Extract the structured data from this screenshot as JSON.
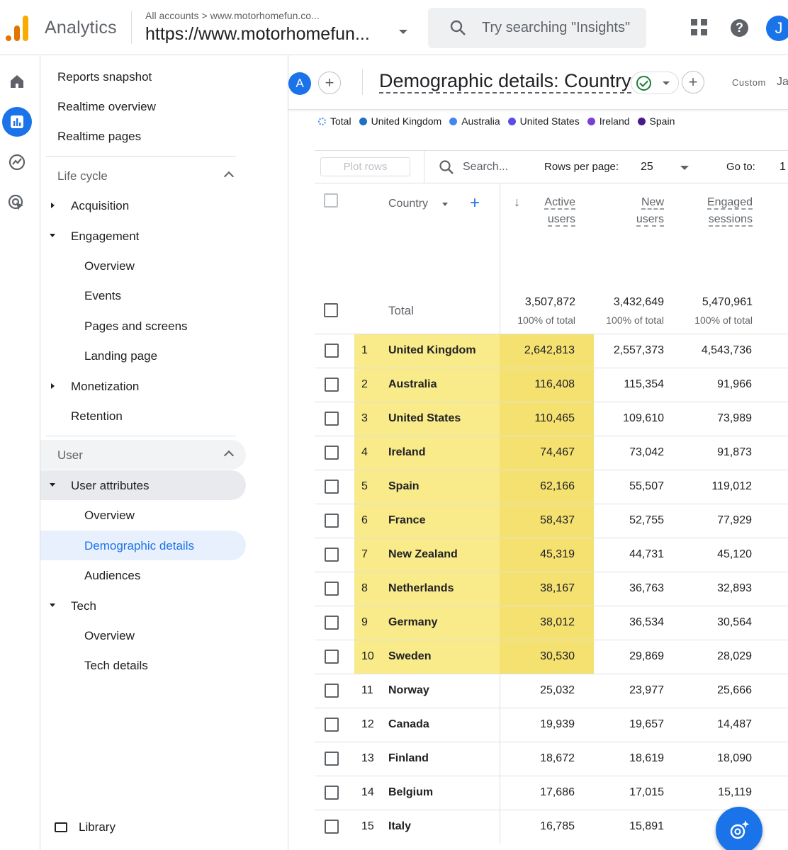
{
  "header": {
    "app_name": "Analytics",
    "breadcrumb_root": "All accounts",
    "breadcrumb_sep": ">",
    "breadcrumb_account": "www.motorhomefun.co...",
    "property": "https://www.motorhomefun...",
    "search_placeholder": "Try searching \"Insights\"",
    "help_glyph": "?",
    "avatar_initial": "J"
  },
  "nav": {
    "reports_snapshot": "Reports snapshot",
    "realtime_overview": "Realtime overview",
    "realtime_pages": "Realtime pages",
    "lifecycle_section": "Life cycle",
    "acquisition": "Acquisition",
    "engagement": "Engagement",
    "eng_overview": "Overview",
    "eng_events": "Events",
    "eng_pages": "Pages and screens",
    "eng_landing": "Landing page",
    "monetization": "Monetization",
    "retention": "Retention",
    "user_section": "User",
    "user_attributes": "User attributes",
    "ua_overview": "Overview",
    "ua_demographic": "Demographic details",
    "ua_audiences": "Audiences",
    "tech": "Tech",
    "tech_overview": "Overview",
    "tech_details": "Tech details",
    "library": "Library"
  },
  "report": {
    "segment_initial": "A",
    "plus": "+",
    "title": "Demographic details: Country",
    "custom_label": "Custom",
    "date_partial": "Ja"
  },
  "legend": [
    {
      "label": "Total",
      "color": "#4285f4"
    },
    {
      "label": "United Kingdom",
      "color": "#1f6fc5"
    },
    {
      "label": "Australia",
      "color": "#4285f4"
    },
    {
      "label": "United States",
      "color": "#5b4ee8"
    },
    {
      "label": "Ireland",
      "color": "#7b3fd6"
    },
    {
      "label": "Spain",
      "color": "#4a1a8c"
    }
  ],
  "toolbar": {
    "plot_rows": "Plot rows",
    "search_placeholder": "Search...",
    "rows_per_page_label": "Rows per page:",
    "rows_per_page_value": "25",
    "goto_label": "Go to:",
    "goto_value": "1"
  },
  "table": {
    "dim_header": "Country",
    "sort_arrow": "↓",
    "metric_headers": [
      {
        "line1": "Active",
        "line2": "users"
      },
      {
        "line1": "New",
        "line2": "users"
      },
      {
        "line1": "Engaged",
        "line2": "sessions"
      }
    ],
    "total_label": "Total",
    "totals": [
      "3,507,872",
      "3,432,649",
      "5,470,961"
    ],
    "totals_pct": [
      "100% of total",
      "100% of total",
      "100% of total"
    ],
    "rows": [
      {
        "n": "1",
        "country": "United Kingdom",
        "active": "2,642,813",
        "new": "2,557,373",
        "engaged": "4,543,736",
        "highlight": true
      },
      {
        "n": "2",
        "country": "Australia",
        "active": "116,408",
        "new": "115,354",
        "engaged": "91,966",
        "highlight": true
      },
      {
        "n": "3",
        "country": "United States",
        "active": "110,465",
        "new": "109,610",
        "engaged": "73,989",
        "highlight": true
      },
      {
        "n": "4",
        "country": "Ireland",
        "active": "74,467",
        "new": "73,042",
        "engaged": "91,873",
        "highlight": true
      },
      {
        "n": "5",
        "country": "Spain",
        "active": "62,166",
        "new": "55,507",
        "engaged": "119,012",
        "highlight": true
      },
      {
        "n": "6",
        "country": "France",
        "active": "58,437",
        "new": "52,755",
        "engaged": "77,929",
        "highlight": true
      },
      {
        "n": "7",
        "country": "New Zealand",
        "active": "45,319",
        "new": "44,731",
        "engaged": "45,120",
        "highlight": true
      },
      {
        "n": "8",
        "country": "Netherlands",
        "active": "38,167",
        "new": "36,763",
        "engaged": "32,893",
        "highlight": true
      },
      {
        "n": "9",
        "country": "Germany",
        "active": "38,012",
        "new": "36,534",
        "engaged": "30,564",
        "highlight": true
      },
      {
        "n": "10",
        "country": "Sweden",
        "active": "30,530",
        "new": "29,869",
        "engaged": "28,029",
        "highlight": true
      },
      {
        "n": "11",
        "country": "Norway",
        "active": "25,032",
        "new": "23,977",
        "engaged": "25,666",
        "highlight": false
      },
      {
        "n": "12",
        "country": "Canada",
        "active": "19,939",
        "new": "19,657",
        "engaged": "14,487",
        "highlight": false
      },
      {
        "n": "13",
        "country": "Finland",
        "active": "18,672",
        "new": "18,619",
        "engaged": "18,090",
        "highlight": false
      },
      {
        "n": "14",
        "country": "Belgium",
        "active": "17,686",
        "new": "17,015",
        "engaged": "15,119",
        "highlight": false
      },
      {
        "n": "15",
        "country": "Italy",
        "active": "16,785",
        "new": "15,891",
        "engaged": "",
        "highlight": false
      }
    ]
  },
  "colors": {
    "accent": "#1a73e8",
    "highlight_row": "#f9ea8a",
    "highlight_metric": "#f4e170"
  }
}
